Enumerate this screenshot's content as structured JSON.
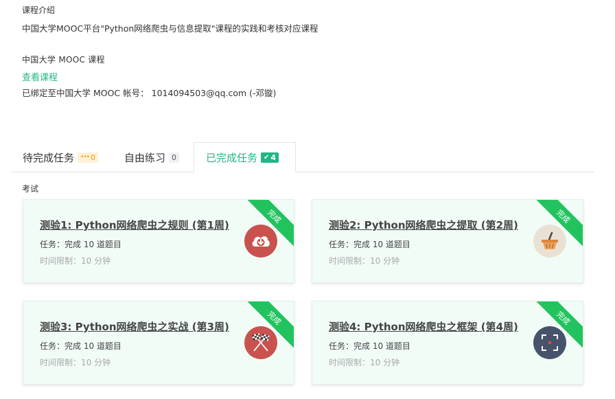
{
  "intro": {
    "title": "课程介绍",
    "description": "中国大学MOOC平台\"Python网络爬虫与信息提取\"课程的实践和考核对应课程"
  },
  "mooc": {
    "label": "中国大学 MOOC 课程",
    "view_link": "查看课程",
    "bound_text": "已绑定至中国大学 MOOC 帐号： 1014094503@qq.com (-邓镟)"
  },
  "tabs": {
    "pending": {
      "label": "待完成任务",
      "badge": "0",
      "badge_icon": "•••"
    },
    "free": {
      "label": "自由练习",
      "badge": "0"
    },
    "done": {
      "label": "已完成任务",
      "badge": "4",
      "badge_icon": "✔"
    }
  },
  "section": {
    "label": "考试"
  },
  "cards": [
    {
      "title": "测验1: Python网络爬虫之规则 (第1周)",
      "task": "任务：完成 10 道题目",
      "time": "时间限制：10 分钟",
      "ribbon": "完成",
      "icon": "cloud-download-icon",
      "icon_color": "#c9524e"
    },
    {
      "title": "测验2: Python网络爬虫之提取 (第2周)",
      "task": "任务：完成 10 道题目",
      "time": "时间限制：10 分钟",
      "ribbon": "完成",
      "icon": "basket-icon",
      "icon_color": "#e9e2d4"
    },
    {
      "title": "测验3: Python网络爬虫之实战 (第3周)",
      "task": "任务：完成 10 道题目",
      "time": "时间限制：10 分钟",
      "ribbon": "完成",
      "icon": "racing-flags-icon",
      "icon_color": "#c9524e"
    },
    {
      "title": "测验4: Python网络爬虫之框架 (第4周)",
      "task": "任务：完成 10 道题目",
      "time": "时间限制：10 分钟",
      "ribbon": "完成",
      "icon": "focus-frame-icon",
      "icon_color": "#46536a"
    }
  ],
  "colors": {
    "accent": "#21b685",
    "ribbon": "#22c35e",
    "card_bg": "#f2fcf7"
  }
}
